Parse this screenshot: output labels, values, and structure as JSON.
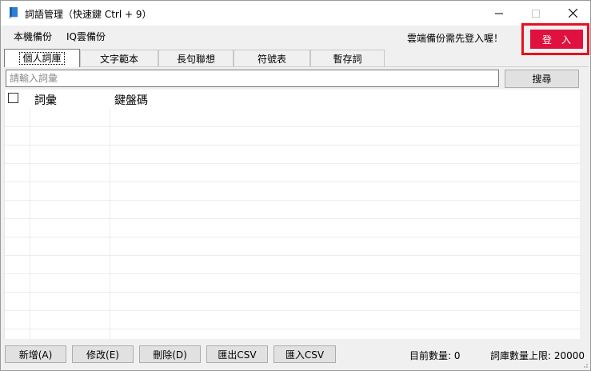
{
  "window": {
    "title": "詞語管理（快速鍵 Ctrl + 9）"
  },
  "menu": {
    "local_backup": "本機備份",
    "cloud_backup": "IQ雲備份"
  },
  "cloud_notice": "雲端備份需先登入喔！",
  "login_button": "登入",
  "tabs": [
    {
      "label": "個人詞庫",
      "active": true
    },
    {
      "label": "文字範本",
      "active": false
    },
    {
      "label": "長句聯想",
      "active": false
    },
    {
      "label": "符號表",
      "active": false
    },
    {
      "label": "暫存詞",
      "active": false
    }
  ],
  "search": {
    "placeholder": "請輸入詞彙",
    "button_label": "搜尋"
  },
  "table": {
    "columns": [
      "詞彙",
      "鍵盤碼"
    ],
    "rows": []
  },
  "bottom": {
    "add_label": "新增(A)",
    "edit_label": "修改(E)",
    "delete_label": "刪除(D)",
    "export_label": "匯出CSV",
    "import_label": "匯入CSV",
    "current_count": "目前數量: 0",
    "limit": "詞庫數量上限: 20000"
  },
  "colors": {
    "login_bg": "#e0113f",
    "highlight_outline": "#e8101e"
  }
}
